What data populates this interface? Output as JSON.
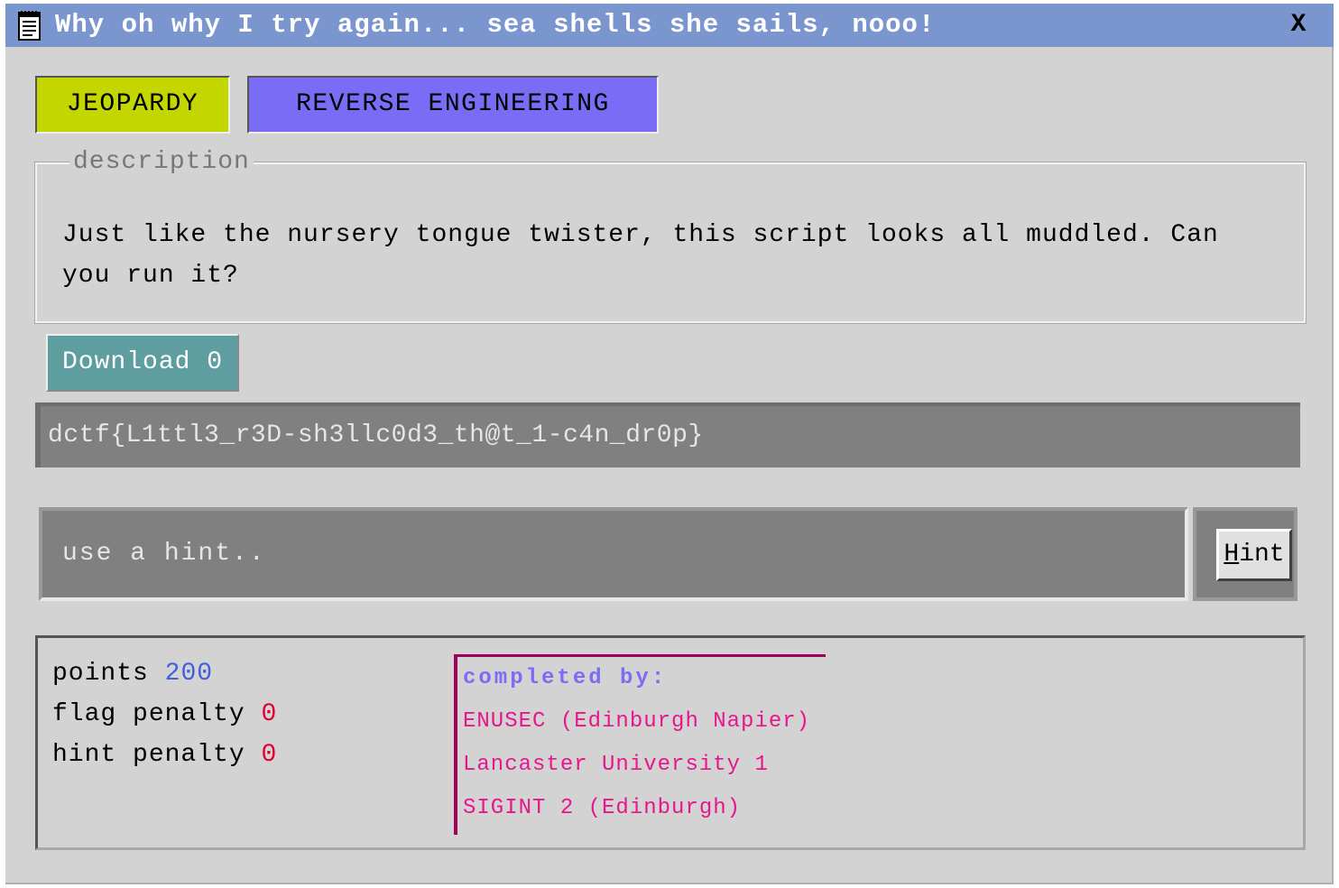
{
  "window": {
    "title": "Why oh why I try again... sea shells she sails, nooo!",
    "close_label": "X"
  },
  "tags": [
    {
      "label": "JEOPARDY",
      "color": "#c4d600"
    },
    {
      "label": "REVERSE ENGINEERING",
      "color": "#7b6cf5"
    }
  ],
  "description": {
    "legend": "description",
    "text": "Just like the nursery tongue twister, this script looks all muddled. Can you run it?"
  },
  "download": {
    "label": "Download 0",
    "color": "#5f9ea0"
  },
  "flag": {
    "value": "dctf{L1ttl3_r3D-sh3llc0d3_th@t_1-c4n_dr0p}"
  },
  "hint": {
    "placeholder": "use a hint..",
    "button_label_first": "H",
    "button_label_rest": "int"
  },
  "stats": {
    "points_label": "points",
    "points_value": "200",
    "flag_penalty_label": "flag penalty",
    "flag_penalty_value": "0",
    "hint_penalty_label": "hint penalty",
    "hint_penalty_value": "0"
  },
  "completed": {
    "title": "completed by:",
    "teams": [
      "ENUSEC (Edinburgh Napier)",
      "Lancaster University 1",
      "SIGINT 2 (Edinburgh)"
    ]
  },
  "colors": {
    "titlebar": "#7b96cf",
    "window_bg": "#d3d3d3",
    "field_bg": "#808080",
    "points_value": "#3f5fdc",
    "penalty_value": "#e00030",
    "completed_title": "#7b6cf5",
    "completed_team": "#e8158c"
  }
}
